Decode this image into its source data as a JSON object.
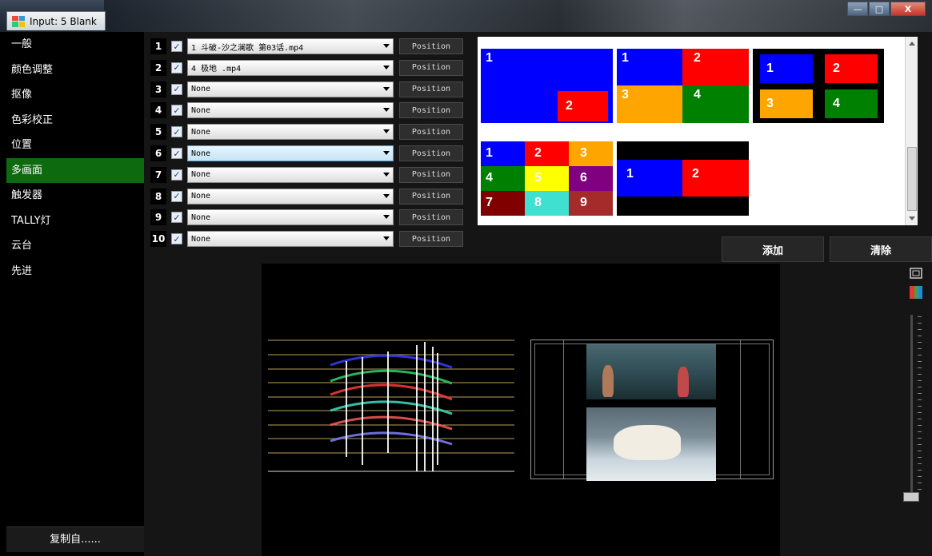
{
  "window": {
    "title": "Input: 5 Blank",
    "minimize_glyph": "—",
    "maximize_glyph": "□",
    "close_glyph": "X"
  },
  "sidebar": {
    "items": [
      {
        "label": "一般"
      },
      {
        "label": "颜色调整"
      },
      {
        "label": "抠像"
      },
      {
        "label": "色彩校正"
      },
      {
        "label": "位置"
      },
      {
        "label": "多画面",
        "active": true
      },
      {
        "label": "触发器"
      },
      {
        "label": "TALLY灯"
      },
      {
        "label": "云台"
      },
      {
        "label": "先进"
      }
    ],
    "copy_from_label": "复制自......"
  },
  "inputs": [
    {
      "num": "1",
      "checked": true,
      "value": "1 斗破-沙之澜歌 第03话.mp4",
      "position_label": "Position"
    },
    {
      "num": "2",
      "checked": true,
      "value": "4 极地 .mp4",
      "position_label": "Position"
    },
    {
      "num": "3",
      "checked": true,
      "value": "None",
      "position_label": "Position"
    },
    {
      "num": "4",
      "checked": true,
      "value": "None",
      "position_label": "Position"
    },
    {
      "num": "5",
      "checked": true,
      "value": "None",
      "position_label": "Position"
    },
    {
      "num": "6",
      "checked": true,
      "value": "None",
      "position_label": "Position",
      "highlighted": true
    },
    {
      "num": "7",
      "checked": true,
      "value": "None",
      "position_label": "Position"
    },
    {
      "num": "8",
      "checked": true,
      "value": "None",
      "position_label": "Position"
    },
    {
      "num": "9",
      "checked": true,
      "value": "None",
      "position_label": "Position"
    },
    {
      "num": "10",
      "checked": true,
      "value": "None",
      "position_label": "Position"
    }
  ],
  "layouts": {
    "colors": {
      "blue": "#0000ff",
      "red": "#ff0000",
      "orange": "#ffa500",
      "green": "#008000",
      "yellow": "#ffff00",
      "purple": "#800080",
      "darkred": "#800000",
      "cyan": "#40e0d0",
      "brown": "#a52a2a",
      "black": "#000000"
    },
    "pip": {
      "cells": [
        "1",
        "2"
      ]
    },
    "quad": {
      "cells": [
        "1",
        "2",
        "3",
        "4"
      ]
    },
    "quad_boxed": {
      "cells": [
        "1",
        "2",
        "3",
        "4"
      ]
    },
    "grid9": {
      "cells": [
        "1",
        "2",
        "3",
        "4",
        "5",
        "6",
        "7",
        "8",
        "9"
      ]
    },
    "side_by_side": {
      "cells": [
        "1",
        "2"
      ]
    }
  },
  "actions": {
    "add_label": "添加",
    "clear_label": "清除"
  },
  "preview": {
    "overlay_text": "..."
  },
  "tools": {
    "frame_icon": "frame-icon",
    "color_icon": "color-bars-icon"
  }
}
